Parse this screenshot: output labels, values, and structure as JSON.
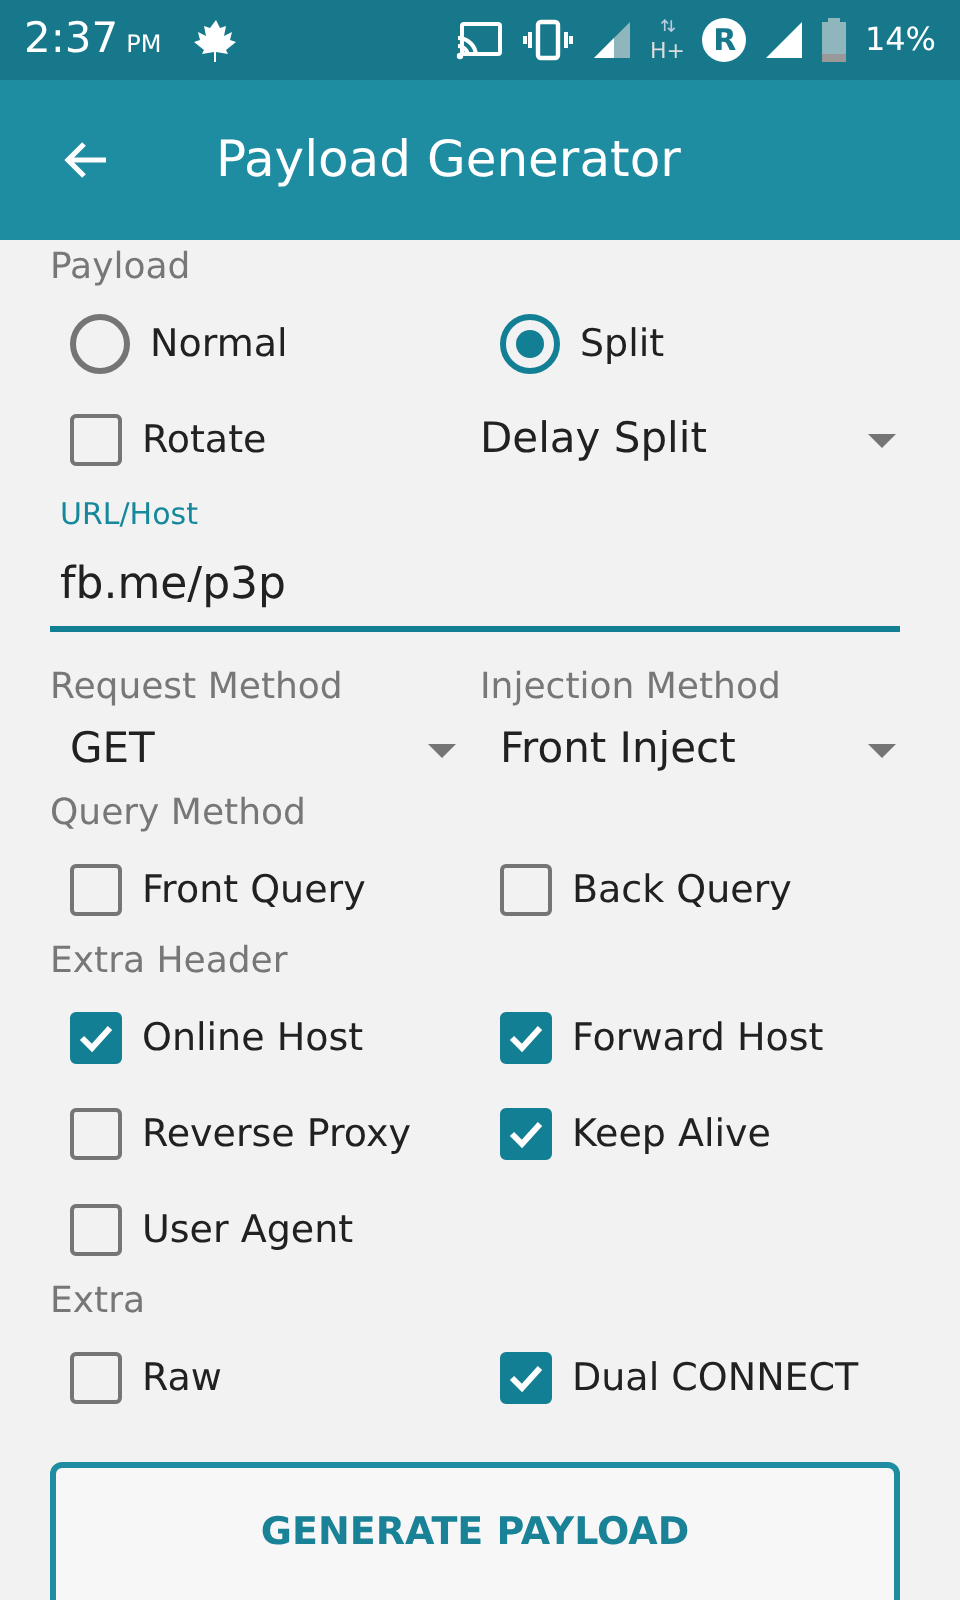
{
  "status_bar": {
    "time": "2:37",
    "ampm": "PM",
    "network": "H+",
    "roaming": "R",
    "battery": "14%"
  },
  "app_bar": {
    "title": "Payload Generator"
  },
  "payload": {
    "label": "Payload",
    "modes": [
      {
        "label": "Normal",
        "selected": false
      },
      {
        "label": "Split",
        "selected": true
      }
    ],
    "rotate": {
      "label": "Rotate",
      "checked": false
    },
    "split_type": "Delay Split"
  },
  "url_host": {
    "label": "URL/Host",
    "value": "fb.me/p3p"
  },
  "methods": [
    {
      "label": "Request Method",
      "value": "GET"
    },
    {
      "label": "Injection Method",
      "value": "Front Inject"
    }
  ],
  "option_groups": [
    {
      "label": "Query Method",
      "options": [
        {
          "label": "Front Query",
          "checked": false
        },
        {
          "label": "Back Query",
          "checked": false
        }
      ]
    },
    {
      "label": "Extra Header",
      "options": [
        {
          "label": "Online Host",
          "checked": true
        },
        {
          "label": "Forward Host",
          "checked": true
        },
        {
          "label": "Reverse Proxy",
          "checked": false
        },
        {
          "label": "Keep Alive",
          "checked": true
        },
        {
          "label": "User Agent",
          "checked": false
        }
      ]
    },
    {
      "label": "Extra",
      "options": [
        {
          "label": "Raw",
          "checked": false
        },
        {
          "label": "Dual CONNECT",
          "checked": true
        }
      ]
    }
  ],
  "button": "GENERATE PAYLOAD"
}
